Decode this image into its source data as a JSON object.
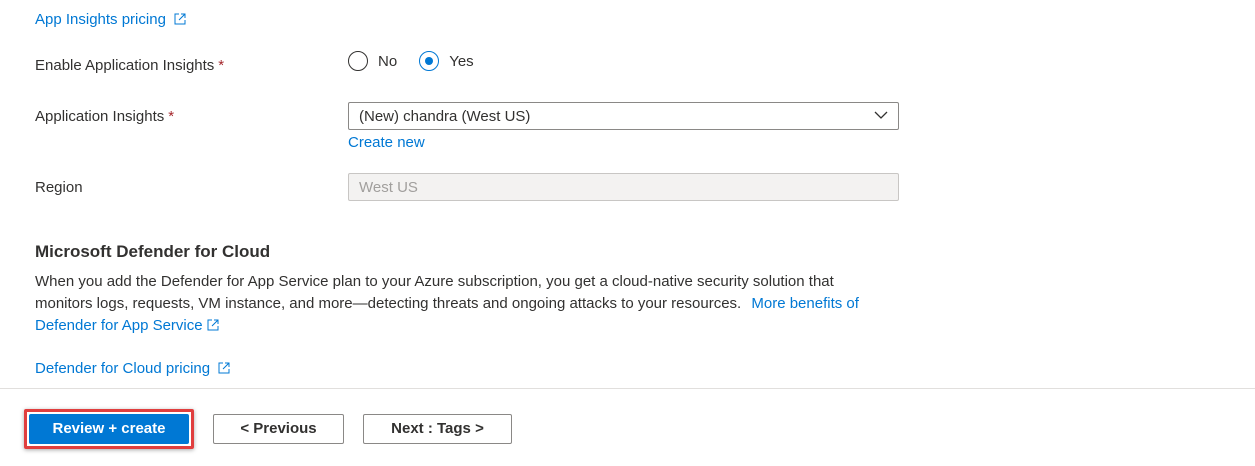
{
  "links": {
    "app_insights_pricing": "App Insights pricing",
    "create_new": "Create new",
    "more_benefits": "More benefits of Defender for App Service",
    "defender_pricing": "Defender for Cloud pricing"
  },
  "fields": {
    "enable_app_insights": {
      "label": "Enable Application Insights",
      "required_mark": "*",
      "options": [
        "No",
        "Yes"
      ],
      "selected": "Yes"
    },
    "app_insights": {
      "label": "Application Insights",
      "required_mark": "*",
      "value": "(New) chandra (West US)"
    },
    "region": {
      "label": "Region",
      "value": "West US"
    }
  },
  "defender": {
    "heading": "Microsoft Defender for Cloud",
    "description": "When you add the Defender for App Service plan to your Azure subscription, you get a cloud-native security solution that monitors logs, requests, VM instance, and more—detecting threats and ongoing attacks to your resources."
  },
  "footer": {
    "review_create": "Review + create",
    "previous": "< Previous",
    "next": "Next : Tags >"
  },
  "colors": {
    "link": "#0078d4",
    "primary": "#0078d4",
    "required": "#a4262c",
    "highlight": "#e03e3e"
  }
}
